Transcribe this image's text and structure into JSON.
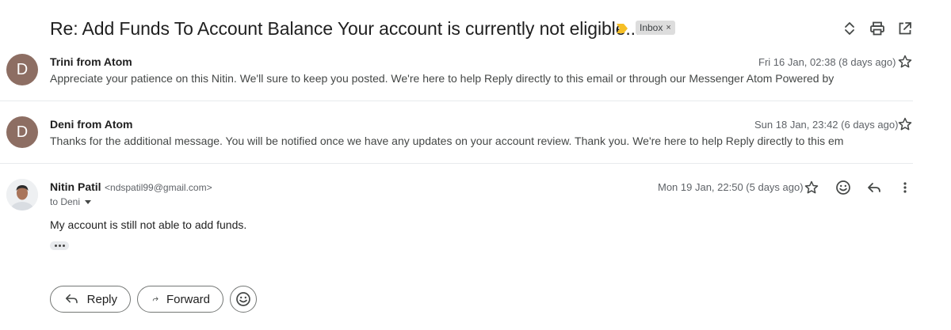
{
  "subject": "Re: Add Funds To Account Balance Your account is currently not eligible...",
  "label_chip": "Inbox",
  "label_chip_close": "×",
  "messages": [
    {
      "avatar_letter": "D",
      "sender": "Trini from Atom",
      "date": "Fri 16 Jan, 02:38 (8 days ago)",
      "snippet": "Appreciate your patience on this Nitin. We'll sure to keep you posted. We're here to help Reply directly to this email or through our Messenger Atom Powered by"
    },
    {
      "avatar_letter": "D",
      "sender": "Deni from Atom",
      "date": "Sun 18 Jan, 23:42 (6 days ago)",
      "snippet": "Thanks for the additional message. You will be notified once we have any updates on your account review. Thank you. We're here to help Reply directly to this em"
    }
  ],
  "expanded": {
    "sender": "Nitin Patil",
    "email": "<ndspatil99@gmail.com>",
    "to": "to Deni",
    "date": "Mon 19 Jan, 22:50 (5 days ago)",
    "body": "My account is still not able to add funds."
  },
  "actions": {
    "reply": "Reply",
    "forward": "Forward"
  },
  "colors": {
    "avatar": "#8d6e63",
    "importance_marker": "#f6bf26",
    "chip_bg": "#dddddd"
  },
  "icons": [
    "importance-marker-icon",
    "expand-collapse-icon",
    "print-icon",
    "open-in-new-window-icon",
    "star-icon",
    "emoji-icon",
    "reply-icon",
    "more-vert-icon",
    "forward-icon",
    "dropdown-caret-icon",
    "ellipsis-icon"
  ]
}
